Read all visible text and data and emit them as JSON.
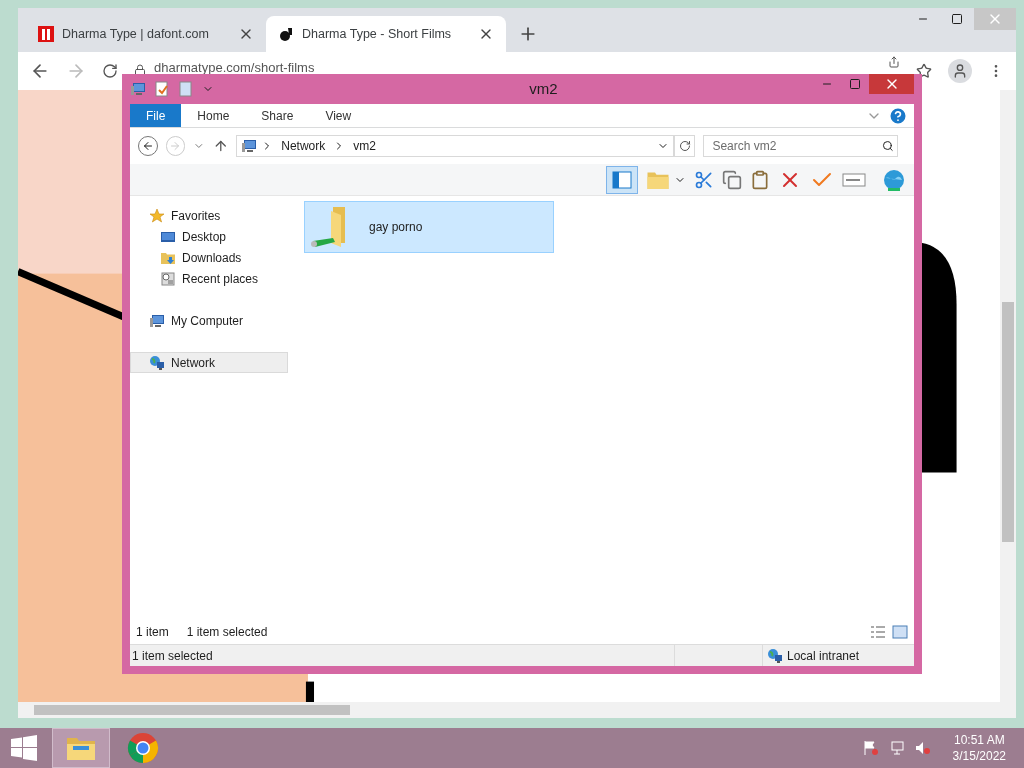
{
  "browser": {
    "tabs": [
      {
        "title": "Dharma Type | dafont.com",
        "selected": false,
        "kind": "dafont"
      },
      {
        "title": "Dharma Type - Short Films",
        "selected": true,
        "kind": "dharma"
      }
    ],
    "url": "dharmatype.com/short-films"
  },
  "explorer": {
    "title": "vm2",
    "ribbon_tabs": [
      {
        "label": "File",
        "selected": true
      },
      {
        "label": "Home",
        "selected": false
      },
      {
        "label": "Share",
        "selected": false
      },
      {
        "label": "View",
        "selected": false
      }
    ],
    "breadcrumbs": [
      "Network",
      "vm2"
    ],
    "search": {
      "placeholder": "Search vm2"
    },
    "nav": [
      {
        "label": "Favorites",
        "kind": "star",
        "selected": false,
        "children": [
          {
            "label": "Desktop",
            "kind": "desktop",
            "selected": false
          },
          {
            "label": "Downloads",
            "kind": "downloads",
            "selected": false
          },
          {
            "label": "Recent places",
            "kind": "recent",
            "selected": false
          }
        ]
      },
      {
        "label": "My Computer",
        "kind": "computer",
        "selected": false
      },
      {
        "label": "Network",
        "kind": "network",
        "selected": true
      }
    ],
    "files": [
      {
        "name": "gay porno",
        "selected": true
      }
    ],
    "item_count": "1 item",
    "selection_count": "1 item selected",
    "status_bar": {
      "text": "1 item selected",
      "zone": "Local intranet"
    }
  },
  "taskbar": {
    "apps": [
      {
        "kind": "explorer",
        "selected": true
      },
      {
        "kind": "chrome",
        "selected": false
      }
    ],
    "clock": {
      "time": "10:51 AM",
      "date": "3/15/2022"
    }
  }
}
